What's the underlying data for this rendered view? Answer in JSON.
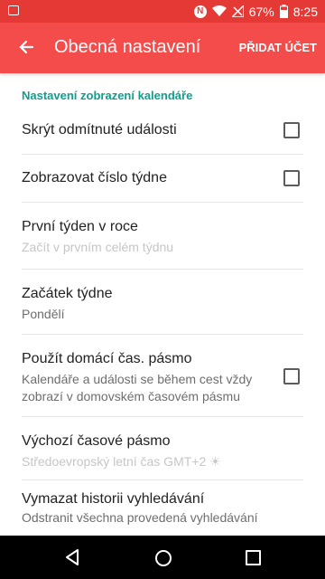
{
  "status_bar": {
    "battery": "67%",
    "time": "8:25"
  },
  "app_bar": {
    "title": "Obecná nastavení",
    "action": "PŘIDAT ÚČET"
  },
  "section_title": "Nastavení zobrazení kalendáře",
  "settings": [
    {
      "title": "Skrýt odmítnuté události",
      "checked": false
    },
    {
      "title": "Zobrazovat číslo týdne",
      "checked": false
    },
    {
      "title": "První týden v roce",
      "subtitle": "Začít v prvním celém týdnu"
    },
    {
      "title": "Začátek týdne",
      "subtitle": "Pondělí"
    },
    {
      "title": "Použít domácí čas. pásmo",
      "subtitle": "Kalendáře a události se během cest vždy zobrazí v domovském časovém pásmu",
      "checked": false
    },
    {
      "title": "Výchozí časové pásmo",
      "subtitle": "Středoevropský letní čas  GMT+2 ☀"
    },
    {
      "title": "Vymazat historii vyhledávání",
      "subtitle": "Odstranit všechna provedená vyhledávání"
    }
  ]
}
